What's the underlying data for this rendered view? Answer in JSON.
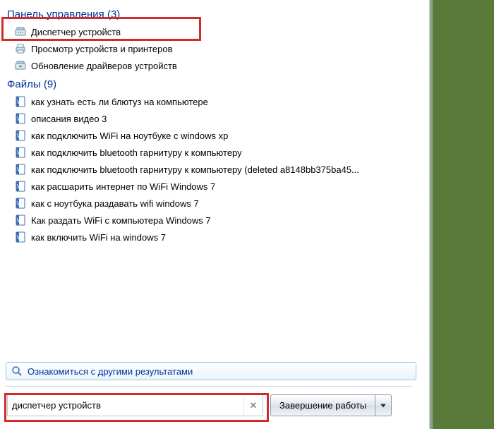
{
  "sections": {
    "control_panel": {
      "header": "Панель управления (3)",
      "items": [
        "Диспетчер устройств",
        "Просмотр устройств и принтеров",
        "Обновление драйверов устройств"
      ]
    },
    "files": {
      "header": "Файлы (9)",
      "items": [
        "как узнать есть ли блютуз на компьютере",
        "описания видео 3",
        "как подключить WiFi на ноутбуке с windows xp",
        "как подключить bluetooth гарнитуру к компьютеру",
        "как подключить bluetooth гарнитуру к компьютеру (deleted a8148bb375ba45...",
        "как расшарить интернет по WiFi Windows 7",
        "как с ноутбука раздавать wifi windows 7",
        "Как раздать WiFi с компьютера Windows 7",
        "как включить WiFi на windows 7"
      ]
    }
  },
  "see_more_label": "Ознакомиться с другими результатами",
  "search": {
    "value": "диспетчер устройств",
    "clear_title": "Очистить"
  },
  "shutdown_label": "Завершение работы",
  "icons": {
    "cp": "control-panel-icon",
    "doc": "word-document-icon",
    "magnifier": "search-icon",
    "close": "close-icon"
  }
}
